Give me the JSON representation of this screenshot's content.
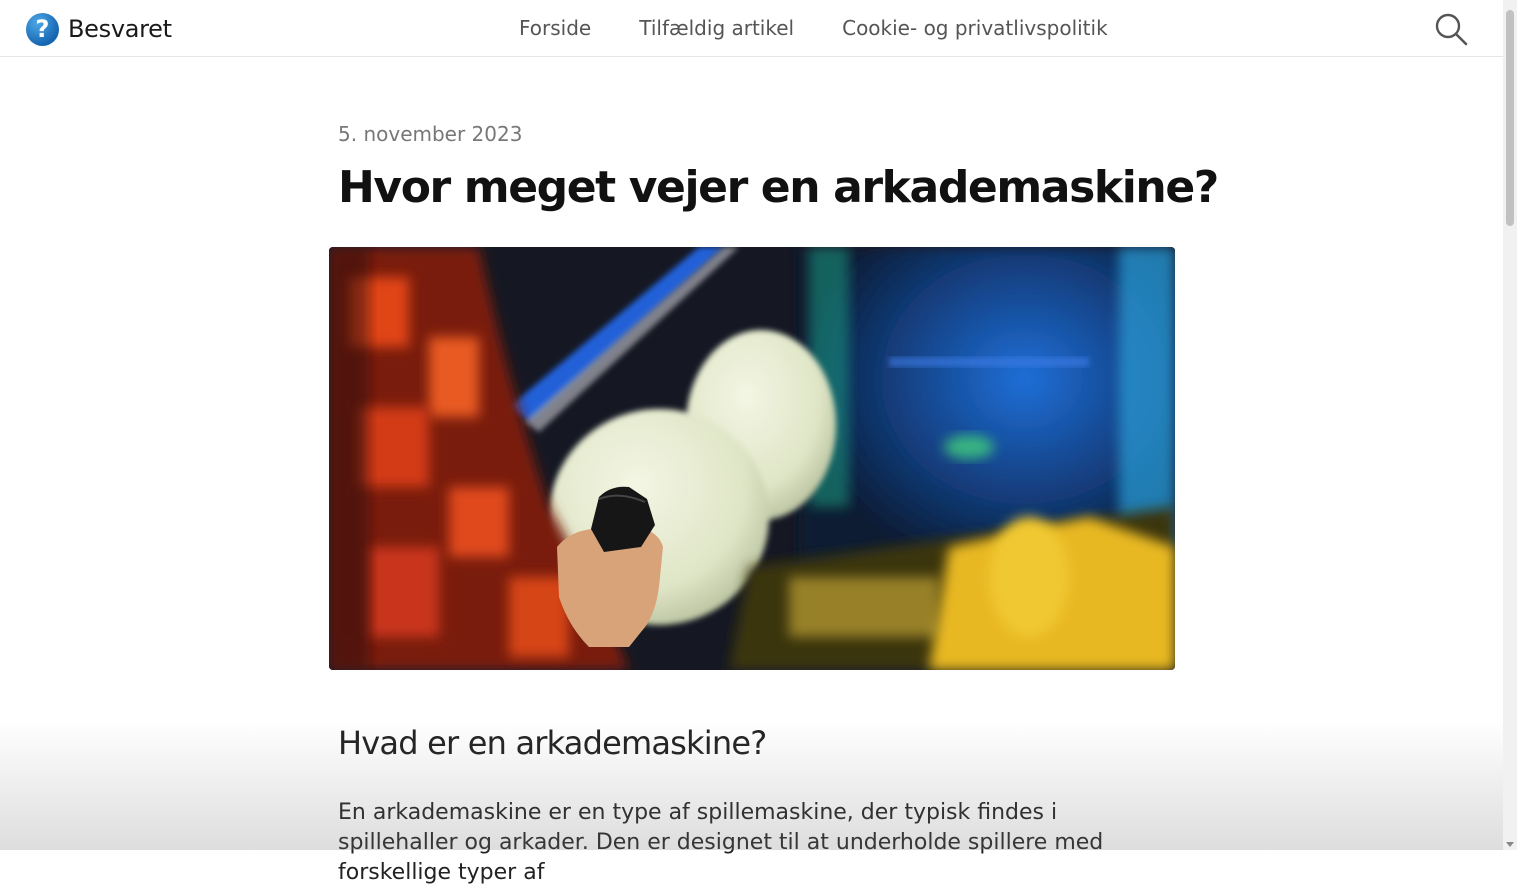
{
  "site": {
    "logo_glyph": "?",
    "name": "Besvaret"
  },
  "nav": [
    {
      "label": "Forside"
    },
    {
      "label": "Tilfældig artikel"
    },
    {
      "label": "Cookie- og privatlivspolitik"
    }
  ],
  "search": {
    "icon": "search-icon"
  },
  "article": {
    "date": "5. november 2023",
    "title": "Hvor meget vejer en arkademaskine?",
    "image": {
      "subject": "person playing arcade machine with light gun",
      "accent_colors": [
        "#d4431c",
        "#e8eccf",
        "#f0c42a",
        "#2a6fd6"
      ]
    },
    "section_heading": "Hvad er en arkademaskine?",
    "paragraph": "En arkademaskine er en type af spillemaskine, der typisk findes i spillehaller og arkader. Den er designet til at underholde spillere med forskellige typer af"
  },
  "colors": {
    "brand": "#1566b0",
    "text": "#111111",
    "muted": "#777777"
  }
}
